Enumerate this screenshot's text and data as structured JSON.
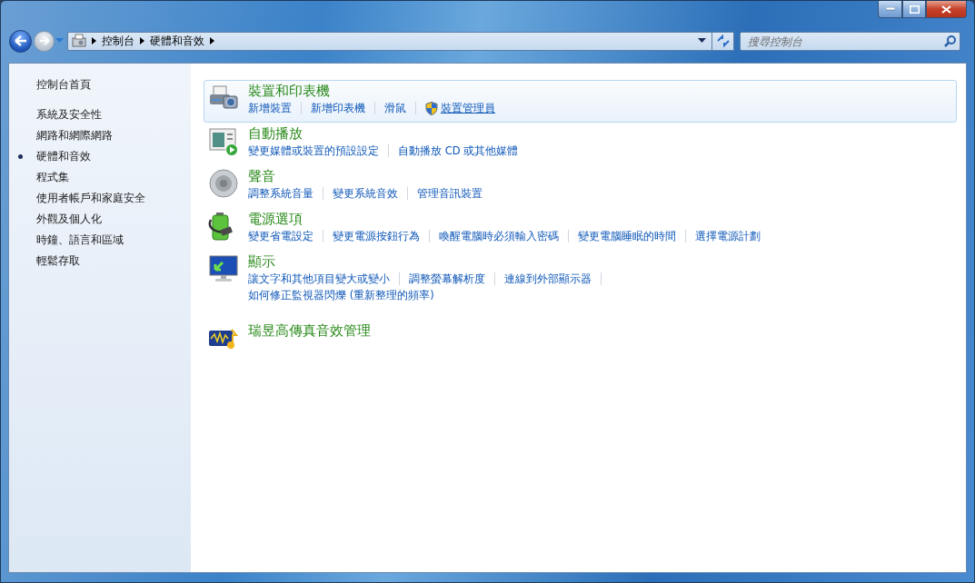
{
  "window": {
    "buttons": [
      {
        "kind": "minimize"
      },
      {
        "kind": "maximize"
      },
      {
        "kind": "close"
      }
    ]
  },
  "address_bar": {
    "breadcrumbs": [
      "控制台",
      "硬體和音效"
    ]
  },
  "search": {
    "placeholder": "搜尋控制台"
  },
  "sidebar": {
    "home": "控制台首頁",
    "items": [
      {
        "label": "系統及安全性",
        "selected": false
      },
      {
        "label": "網路和網際網路",
        "selected": false
      },
      {
        "label": "硬體和音效",
        "selected": true
      },
      {
        "label": "程式集",
        "selected": false
      },
      {
        "label": "使用者帳戶和家庭安全",
        "selected": false
      },
      {
        "label": "外觀及個人化",
        "selected": false
      },
      {
        "label": "時鐘、語言和區域",
        "selected": false
      },
      {
        "label": "輕鬆存取",
        "selected": false
      }
    ]
  },
  "categories": [
    {
      "kind": "devices",
      "title": "裝置和印表機",
      "highlighted": true,
      "lines": [
        {
          "trailing_separator": false,
          "links": [
            {
              "label": "新增裝置",
              "shield": false,
              "hovered": false
            },
            {
              "label": "新增印表機",
              "shield": false,
              "hovered": false
            },
            {
              "label": "滑鼠",
              "shield": false,
              "hovered": false
            },
            {
              "label": "裝置管理員",
              "shield": true,
              "hovered": true
            }
          ]
        }
      ]
    },
    {
      "kind": "autoplay",
      "title": "自動播放",
      "highlighted": false,
      "lines": [
        {
          "trailing_separator": false,
          "links": [
            {
              "label": "變更媒體或裝置的預設設定",
              "shield": false,
              "hovered": false
            },
            {
              "label": "自動播放 CD 或其他媒體",
              "shield": false,
              "hovered": false
            }
          ]
        }
      ]
    },
    {
      "kind": "sound",
      "title": "聲音",
      "highlighted": false,
      "lines": [
        {
          "trailing_separator": false,
          "links": [
            {
              "label": "調整系統音量",
              "shield": false,
              "hovered": false
            },
            {
              "label": "變更系統音效",
              "shield": false,
              "hovered": false
            },
            {
              "label": "管理音訊裝置",
              "shield": false,
              "hovered": false
            }
          ]
        }
      ]
    },
    {
      "kind": "power",
      "title": "電源選項",
      "highlighted": false,
      "lines": [
        {
          "trailing_separator": false,
          "links": [
            {
              "label": "變更省電設定",
              "shield": false,
              "hovered": false
            },
            {
              "label": "變更電源按鈕行為",
              "shield": false,
              "hovered": false
            },
            {
              "label": "喚醒電腦時必須輸入密碼",
              "shield": false,
              "hovered": false
            },
            {
              "label": "變更電腦睡眠的時間",
              "shield": false,
              "hovered": false
            },
            {
              "label": "選擇電源計劃",
              "shield": false,
              "hovered": false
            }
          ]
        }
      ]
    },
    {
      "kind": "display",
      "title": "顯示",
      "highlighted": false,
      "lines": [
        {
          "trailing_separator": true,
          "links": [
            {
              "label": "讓文字和其他項目變大或變小",
              "shield": false,
              "hovered": false
            },
            {
              "label": "調整螢幕解析度",
              "shield": false,
              "hovered": false
            },
            {
              "label": "連線到外部顯示器",
              "shield": false,
              "hovered": false
            }
          ]
        },
        {
          "trailing_separator": false,
          "links": [
            {
              "label": "如何修正監視器閃爍 (重新整理的頻率)",
              "shield": false,
              "hovered": false
            }
          ]
        }
      ]
    },
    {
      "kind": "audio_manager",
      "title": "瑞昱高傳真音效管理",
      "highlighted": false
    }
  ]
}
